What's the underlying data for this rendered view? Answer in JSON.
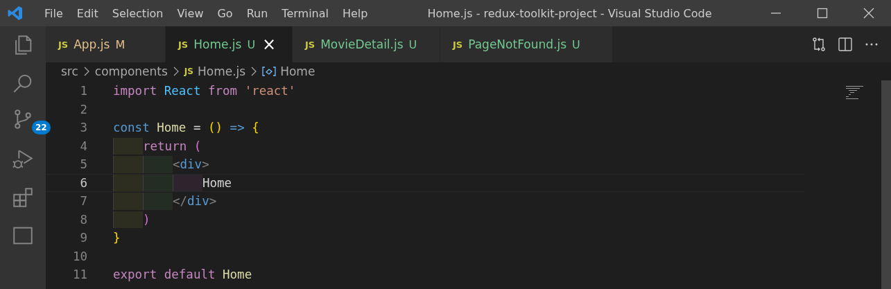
{
  "window": {
    "title": "Home.js - redux-toolkit-project - Visual Studio Code"
  },
  "menu": [
    "File",
    "Edit",
    "Selection",
    "View",
    "Go",
    "Run",
    "Terminal",
    "Help"
  ],
  "activity_bar": [
    {
      "kind": "explorer",
      "selected": false
    },
    {
      "kind": "search",
      "selected": false
    },
    {
      "kind": "source-control",
      "selected": false,
      "badge": "22"
    },
    {
      "kind": "run-debug",
      "selected": false
    },
    {
      "kind": "extensions",
      "selected": false
    },
    {
      "kind": "panel",
      "selected": false
    }
  ],
  "tabs": [
    {
      "icon": "JS",
      "label": "App.js",
      "status": "M",
      "selected": false
    },
    {
      "icon": "JS",
      "label": "Home.js",
      "status": "U",
      "selected": true,
      "close": "×"
    },
    {
      "icon": "JS",
      "label": "MovieDetail.js",
      "status": "U",
      "selected": false
    },
    {
      "icon": "JS",
      "label": "PageNotFound.js",
      "status": "U",
      "selected": false
    }
  ],
  "breadcrumb": [
    {
      "kind": "folder",
      "label": "src"
    },
    {
      "kind": "folder",
      "label": "components"
    },
    {
      "kind": "file",
      "icon": "JS",
      "label": "Home.js"
    },
    {
      "kind": "symbol",
      "label": "Home"
    }
  ],
  "lines": [
    {
      "number": "1",
      "selected": false,
      "tokens": [
        {
          "text": "import",
          "kind": "keyword"
        },
        {
          "text": "React",
          "kind": "variable",
          "spaced": true
        },
        {
          "text": "from",
          "kind": "keyword",
          "spaced": true
        },
        {
          "text": "'react'",
          "kind": "string",
          "spaced": true
        }
      ]
    },
    {
      "number": "2",
      "selected": false
    },
    {
      "number": "3",
      "selected": false,
      "tokens": [
        {
          "text": "const",
          "kind": "storage"
        },
        {
          "text": "Home",
          "kind": "function",
          "spaced": true
        },
        {
          "text": "=",
          "kind": "plain",
          "spaced": true
        },
        {
          "text": "()",
          "kind": "bracket",
          "spaced": true
        },
        {
          "text": "=>",
          "kind": "storage",
          "spaced": true
        },
        {
          "text": "{",
          "kind": "bracket",
          "spaced": true
        }
      ],
      "children": [
        {
          "number": "4",
          "selected": false,
          "tokens": [
            {
              "text": "return",
              "kind": "keyword"
            },
            {
              "text": "(",
              "kind": "bracket2",
              "spaced": true
            }
          ],
          "children": [
            {
              "number": "5",
              "selected": false,
              "tokens": [
                {
                  "text": "<",
                  "kind": "tagpunct"
                },
                {
                  "text": "div",
                  "kind": "tag"
                },
                {
                  "text": ">",
                  "kind": "tagpunct"
                }
              ],
              "children": [
                {
                  "number": "6",
                  "selected": true,
                  "tokens": [
                    {
                      "text": "Home",
                      "kind": "plain"
                    }
                  ]
                }
              ]
            },
            {
              "number": "7",
              "selected": false,
              "tokens": [
                {
                  "text": "</",
                  "kind": "tagpunct"
                },
                {
                  "text": "div",
                  "kind": "tag"
                },
                {
                  "text": ">",
                  "kind": "tagpunct"
                }
              ]
            }
          ]
        },
        {
          "number": "8",
          "selected": false,
          "tokens": [
            {
              "text": ")",
              "kind": "bracket2"
            }
          ]
        }
      ]
    },
    {
      "number": "9",
      "selected": false,
      "tokens": [
        {
          "text": "}",
          "kind": "bracket"
        }
      ]
    },
    {
      "number": "10",
      "selected": false
    },
    {
      "number": "11",
      "selected": false,
      "tokens": [
        {
          "text": "export",
          "kind": "keyword"
        },
        {
          "text": "default",
          "kind": "keyword",
          "spaced": true
        },
        {
          "text": "Home",
          "kind": "function",
          "spaced": true
        }
      ]
    }
  ]
}
